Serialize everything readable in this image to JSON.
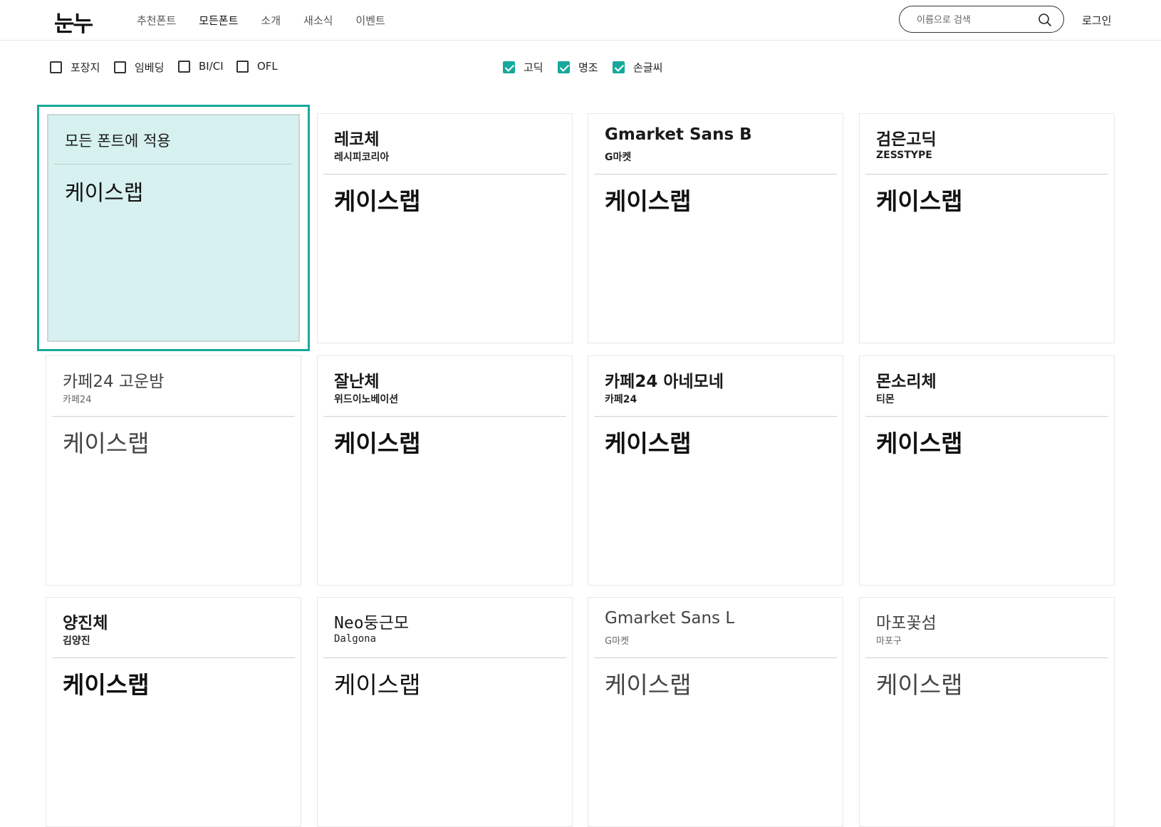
{
  "header": {
    "logo": "눈누",
    "nav": [
      "추천폰트",
      "모든폰트",
      "소개",
      "새소식",
      "이벤트"
    ],
    "active_nav": "모든폰트",
    "search_placeholder": "이름으로 검색",
    "login": "로그인"
  },
  "filters": {
    "license": [
      {
        "label": "포장지",
        "checked": false
      },
      {
        "label": "임베딩",
        "checked": false
      },
      {
        "label": "BI/CI",
        "checked": false
      },
      {
        "label": "OFL",
        "checked": false
      }
    ],
    "style": [
      {
        "label": "고딕",
        "checked": true
      },
      {
        "label": "명조",
        "checked": true
      },
      {
        "label": "손글씨",
        "checked": true
      }
    ]
  },
  "apply_all": {
    "title": "모든 폰트에 적용",
    "sample": "케이스랩"
  },
  "fonts": [
    {
      "name": "레코체",
      "maker": "레시피코리아",
      "sample": "케이스랩"
    },
    {
      "name": "Gmarket Sans B",
      "maker": "G마켓",
      "sample": "케이스랩"
    },
    {
      "name": "검은고딕",
      "maker": "ZESSTYPE",
      "sample": "케이스랩"
    },
    {
      "name": "카페24 고운밤",
      "maker": "카페24",
      "sample": "케이스랩"
    },
    {
      "name": "잘난체",
      "maker": "위드이노베이션",
      "sample": "케이스랩"
    },
    {
      "name": "카페24 아네모네",
      "maker": "카페24",
      "sample": "케이스랩"
    },
    {
      "name": "몬소리체",
      "maker": "티몬",
      "sample": "케이스랩"
    },
    {
      "name": "양진체",
      "maker": "김양진",
      "sample": "케이스랩"
    },
    {
      "name": "Neo둥근모",
      "maker": "Dalgona",
      "sample": "케이스랩"
    },
    {
      "name": "Gmarket Sans L",
      "maker": "G마켓",
      "sample": "케이스랩"
    },
    {
      "name": "마포꽃섬",
      "maker": "마포구",
      "sample": "케이스랩"
    }
  ],
  "colors": {
    "accent": "#17a99a",
    "apply_bg": "#d6f1ef"
  }
}
